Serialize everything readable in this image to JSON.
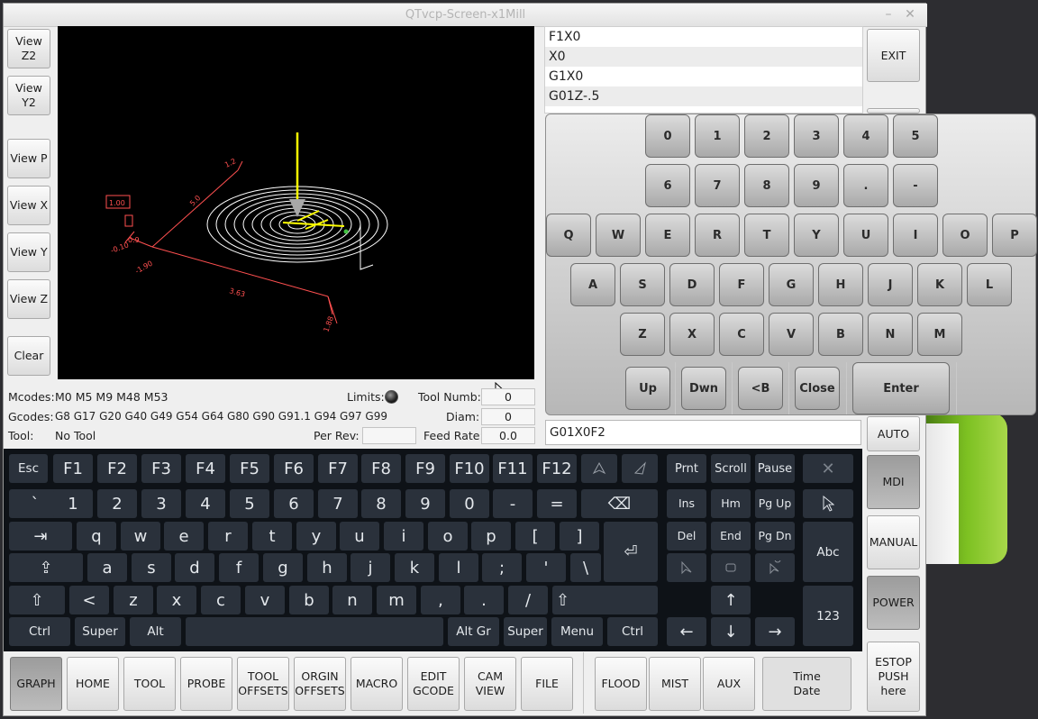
{
  "window": {
    "title": "QTvcp-Screen-x1Mill",
    "minimize": "–",
    "close": "✕"
  },
  "view_buttons": [
    "View Z2",
    "View Y2",
    "View P",
    "View X",
    "View Y",
    "View Z",
    "Clear"
  ],
  "graphics": {
    "labels": [
      "1.00",
      "3.63",
      "1.88",
      "-1.90",
      "-0.10",
      "0.9",
      "5.0",
      "1.2"
    ]
  },
  "mdi_history": [
    "F1X0",
    "X0",
    "G1X0",
    "G01Z-.5"
  ],
  "mdi_input": "G01X0F2",
  "right_buttons": {
    "exit": "EXIT",
    "auto": "AUTO",
    "mdi": "MDI",
    "manual": "MANUAL",
    "power": "POWER",
    "estop": "ESTOP PUSH here"
  },
  "info": {
    "mcodes_label": "Mcodes:",
    "mcodes": "M0 M5 M9 M48 M53",
    "gcodes_label": "Gcodes:",
    "gcodes": "G8 G17 G20 G40 G49 G54 G64 G80 G90 G91.1 G94 G97 G99",
    "tool_label": "Tool:",
    "tool": "No Tool",
    "limits_label": "Limits:",
    "toolnum_label": "Tool Numb:",
    "toolnum": "0",
    "diam_label": "Diam:",
    "diam": "0",
    "perrev_label": "Per Rev:",
    "perrev": "",
    "feed_label": "Feed Rate:",
    "feed": "0.0"
  },
  "virtual_keyboard": {
    "row1": [
      "0",
      "1",
      "2",
      "3",
      "4",
      "5"
    ],
    "row2": [
      "6",
      "7",
      "8",
      "9",
      ".",
      "-"
    ],
    "row3": [
      "Q",
      "W",
      "E",
      "R",
      "T",
      "Y",
      "U",
      "I",
      "O",
      "P"
    ],
    "row4": [
      "A",
      "S",
      "D",
      "F",
      "G",
      "H",
      "J",
      "K",
      "L"
    ],
    "row5": [
      "Z",
      "X",
      "C",
      "V",
      "B",
      "N",
      "M"
    ],
    "bottom": {
      "up": "Up",
      "dwn": "Dwn",
      "back": "<B",
      "close": "Close",
      "enter": "Enter"
    }
  },
  "osk": {
    "fkeys": [
      "Esc",
      "F1",
      "F2",
      "F3",
      "F4",
      "F5",
      "F6",
      "F7",
      "F8",
      "F9",
      "F10",
      "F11",
      "F12"
    ],
    "num_row": [
      "`",
      "1",
      "2",
      "3",
      "4",
      "5",
      "6",
      "7",
      "8",
      "9",
      "0",
      "-",
      "="
    ],
    "q_row": [
      "q",
      "w",
      "e",
      "r",
      "t",
      "y",
      "u",
      "i",
      "o",
      "p",
      "[",
      "]"
    ],
    "a_row": [
      "a",
      "s",
      "d",
      "f",
      "g",
      "h",
      "j",
      "k",
      "l",
      ";",
      "'",
      "\\"
    ],
    "z_row": [
      "<",
      "z",
      "x",
      "c",
      "v",
      "b",
      "n",
      "m",
      ",",
      ".",
      "/"
    ],
    "bottom": {
      "ctrl": "Ctrl",
      "super": "Super",
      "alt": "Alt",
      "altgr": "Alt Gr",
      "super2": "Super",
      "menu": "Menu",
      "ctrl2": "Ctrl"
    },
    "symbols": {
      "tab": "⇥",
      "caps": "⇪",
      "shift": "⇧",
      "backspace": "⌫",
      "enter": "⏎",
      "up": "↑",
      "down": "↓",
      "left": "←",
      "right": "→",
      "close": "✕"
    },
    "nav": {
      "prnt": "Prnt",
      "scroll": "Scroll",
      "pause": "Pause",
      "ins": "Ins",
      "hm": "Hm",
      "pgup": "Pg Up",
      "del": "Del",
      "end": "End",
      "pgdn": "Pg Dn",
      "abc": "Abc",
      "num": "123"
    }
  },
  "bottom_tabs": [
    "GRAPH",
    "HOME",
    "TOOL",
    "PROBE",
    "TOOL OFFSETS",
    "ORGIN OFFSETS",
    "MACRO",
    "EDIT GCODE",
    "CAM VIEW",
    "FILE"
  ],
  "coolant": [
    "FLOOD",
    "MIST",
    "AUX"
  ],
  "time_date": "Time Date",
  "colors": {
    "toolpath": "#ffffff",
    "extents": "#ff4444",
    "tool": "#ffff00"
  }
}
